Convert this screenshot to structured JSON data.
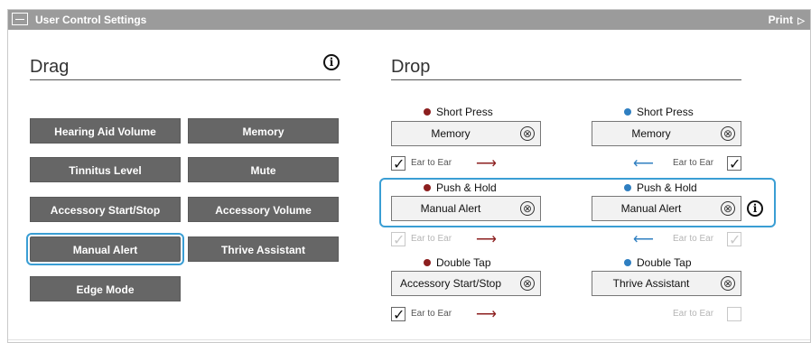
{
  "header": {
    "title": "User Control Settings",
    "print_label": "Print"
  },
  "sections": {
    "drag_title": "Drag",
    "drop_title": "Drop"
  },
  "drag": {
    "buttons": [
      {
        "label": "Hearing Aid Volume"
      },
      {
        "label": "Memory"
      },
      {
        "label": "Tinnitus Level"
      },
      {
        "label": "Mute"
      },
      {
        "label": "Accessory Start/Stop"
      },
      {
        "label": "Accessory Volume"
      },
      {
        "label": "Manual Alert"
      },
      {
        "label": "Thrive Assistant"
      },
      {
        "label": "Edge Mode"
      }
    ]
  },
  "drop": {
    "left": [
      {
        "label": "Short Press",
        "value": "Memory",
        "ear_to_ear": {
          "text": "Ear to Ear",
          "checked": true,
          "enabled": true
        }
      },
      {
        "label": "Push & Hold",
        "value": "Manual Alert",
        "ear_to_ear": {
          "text": "Ear to Ear",
          "checked": true,
          "enabled": false
        }
      },
      {
        "label": "Double Tap",
        "value": "Accessory Start/Stop",
        "ear_to_ear": {
          "text": "Ear to Ear",
          "checked": true,
          "enabled": true
        }
      }
    ],
    "right": [
      {
        "label": "Short Press",
        "value": "Memory",
        "ear_to_ear": {
          "text": "Ear to Ear",
          "checked": true,
          "enabled": true
        }
      },
      {
        "label": "Push & Hold",
        "value": "Manual Alert",
        "ear_to_ear": {
          "text": "Ear to Ear",
          "checked": true,
          "enabled": false
        }
      },
      {
        "label": "Double Tap",
        "value": "Thrive Assistant",
        "ear_to_ear": {
          "text": "Ear to Ear",
          "checked": false,
          "enabled": false
        }
      }
    ]
  },
  "icons": {
    "info": "i",
    "clear": "⊗",
    "arrow_right": "⟶",
    "arrow_left": "⟵"
  },
  "colors": {
    "left_dot": "#8c1f1f",
    "right_dot": "#2f7fc1",
    "highlight": "#3a9ed4"
  }
}
